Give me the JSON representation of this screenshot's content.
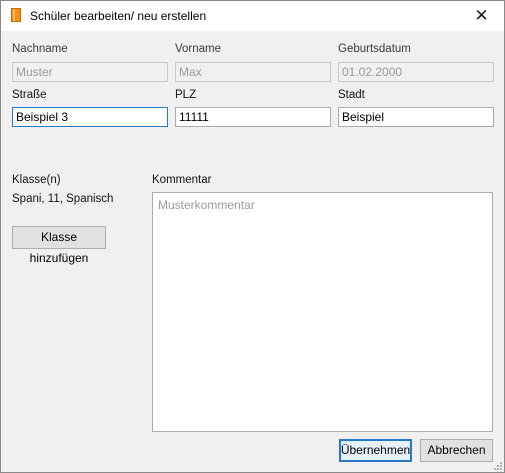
{
  "window": {
    "title": "Schüler bearbeiten/ neu erstellen",
    "close_glyph": "✕",
    "icon": "orange-book-icon"
  },
  "fields": {
    "nachname": {
      "label": "Nachname",
      "value": "",
      "placeholder": "Muster",
      "disabled": true
    },
    "vorname": {
      "label": "Vorname",
      "value": "",
      "placeholder": "Max",
      "disabled": true
    },
    "geburtsdatum": {
      "label": "Geburtsdatum",
      "value": "",
      "placeholder": "01.02.2000",
      "disabled": true
    },
    "strasse": {
      "label": "Straße",
      "value": "Beispiel 3",
      "focused": true
    },
    "plz": {
      "label": "PLZ",
      "value": "11111"
    },
    "stadt": {
      "label": "Stadt",
      "value": "Beispiel"
    }
  },
  "klassen": {
    "label": "Klasse(n)",
    "value": "Spani, 11, Spanisch",
    "add_button": "Klasse hinzufügen"
  },
  "kommentar": {
    "label": "Kommentar",
    "value": "",
    "placeholder": "Musterkommentar"
  },
  "buttons": {
    "ok": "Übernehmen",
    "cancel": "Abbrechen"
  },
  "colors": {
    "focus_border": "#2a76c6",
    "dialog_bg": "#f0f0f0",
    "icon_orange": "#f28c1b"
  }
}
